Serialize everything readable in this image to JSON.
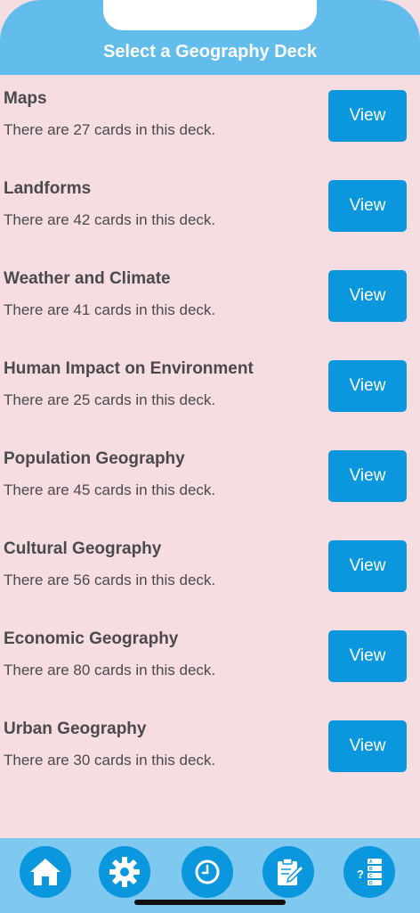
{
  "header": {
    "title": "Select a Geography Deck"
  },
  "decks": [
    {
      "title": "Maps",
      "description": "There are 27 cards in this deck.",
      "button": "View"
    },
    {
      "title": "Landforms",
      "description": "There are 42 cards in this deck.",
      "button": "View"
    },
    {
      "title": "Weather and Climate",
      "description": "There are 41 cards in this deck.",
      "button": "View"
    },
    {
      "title": "Human Impact on Environment",
      "description": "There are 25 cards in this deck.",
      "button": "View"
    },
    {
      "title": "Population Geography",
      "description": "There are 45 cards in this deck.",
      "button": "View"
    },
    {
      "title": "Cultural Geography",
      "description": "There are 56 cards in this deck.",
      "button": "View"
    },
    {
      "title": "Economic Geography",
      "description": "There are 80 cards in this deck.",
      "button": "View"
    },
    {
      "title": "Urban Geography",
      "description": "There are 30 cards in this deck.",
      "button": "View"
    }
  ],
  "tabbar": {
    "icons": [
      "home-icon",
      "gear-icon",
      "clock-icon",
      "notepad-pencil-icon",
      "quiz-list-icon"
    ]
  },
  "colors": {
    "header": "#63bdec",
    "background": "#f6dde1",
    "button": "#0a97de",
    "tabbar": "#7fc8f0"
  }
}
